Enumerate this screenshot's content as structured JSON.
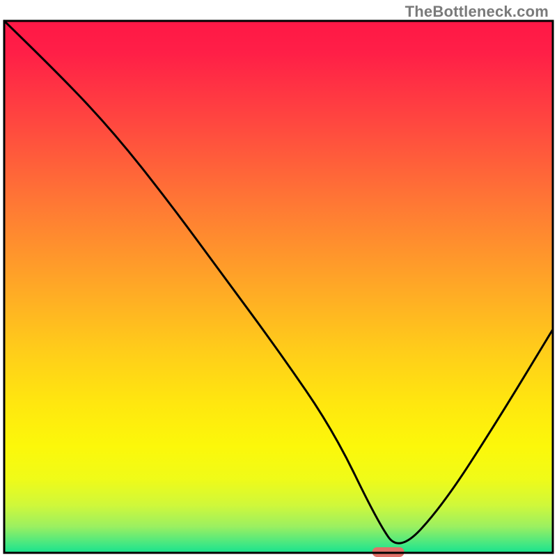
{
  "watermark": "TheBottleneck.com",
  "chart_data": {
    "type": "line",
    "title": "",
    "xlabel": "",
    "ylabel": "",
    "xlim": [
      0,
      100
    ],
    "ylim": [
      0,
      100
    ],
    "x": [
      0,
      10,
      20,
      30,
      40,
      50,
      60,
      68,
      72,
      80,
      90,
      100
    ],
    "values": [
      100,
      90,
      79,
      66,
      52,
      38,
      23,
      6,
      0,
      9,
      25,
      42
    ],
    "marker": {
      "x": 70,
      "y": 0
    },
    "grid": false,
    "gradient_stops": [
      {
        "offset": 0.0,
        "color": "#ff1846"
      },
      {
        "offset": 0.06,
        "color": "#ff1f47"
      },
      {
        "offset": 0.2,
        "color": "#ff4a3f"
      },
      {
        "offset": 0.35,
        "color": "#ff7a34"
      },
      {
        "offset": 0.5,
        "color": "#ffa826"
      },
      {
        "offset": 0.62,
        "color": "#ffcd1a"
      },
      {
        "offset": 0.72,
        "color": "#ffe70f"
      },
      {
        "offset": 0.8,
        "color": "#fcf80a"
      },
      {
        "offset": 0.86,
        "color": "#f0fb18"
      },
      {
        "offset": 0.91,
        "color": "#d0f83a"
      },
      {
        "offset": 0.95,
        "color": "#9cf060"
      },
      {
        "offset": 0.985,
        "color": "#3fe784"
      },
      {
        "offset": 1.0,
        "color": "#17e38e"
      }
    ],
    "marker_color": "#e07068",
    "line_color": "#000000",
    "border_color": "#000000"
  }
}
